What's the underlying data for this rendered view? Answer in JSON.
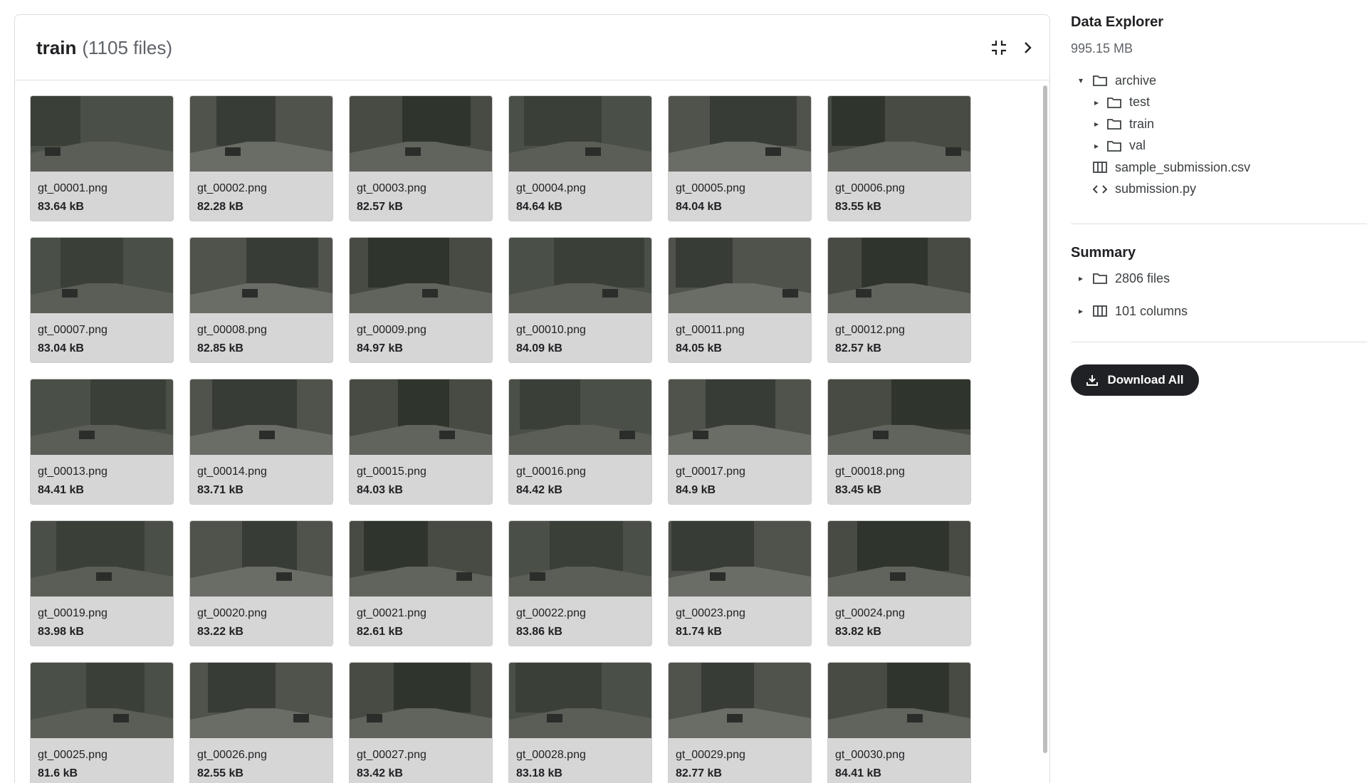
{
  "folder": {
    "name": "train",
    "count_label": "(1105 files)"
  },
  "files": [
    {
      "name": "gt_00001.png",
      "size": "83.64 kB"
    },
    {
      "name": "gt_00002.png",
      "size": "82.28 kB"
    },
    {
      "name": "gt_00003.png",
      "size": "82.57 kB"
    },
    {
      "name": "gt_00004.png",
      "size": "84.64 kB"
    },
    {
      "name": "gt_00005.png",
      "size": "84.04 kB"
    },
    {
      "name": "gt_00006.png",
      "size": "83.55 kB"
    },
    {
      "name": "gt_00007.png",
      "size": "83.04 kB"
    },
    {
      "name": "gt_00008.png",
      "size": "82.85 kB"
    },
    {
      "name": "gt_00009.png",
      "size": "84.97 kB"
    },
    {
      "name": "gt_00010.png",
      "size": "84.09 kB"
    },
    {
      "name": "gt_00011.png",
      "size": "84.05 kB"
    },
    {
      "name": "gt_00012.png",
      "size": "82.57 kB"
    },
    {
      "name": "gt_00013.png",
      "size": "84.41 kB"
    },
    {
      "name": "gt_00014.png",
      "size": "83.71 kB"
    },
    {
      "name": "gt_00015.png",
      "size": "84.03 kB"
    },
    {
      "name": "gt_00016.png",
      "size": "84.42 kB"
    },
    {
      "name": "gt_00017.png",
      "size": "84.9 kB"
    },
    {
      "name": "gt_00018.png",
      "size": "83.45 kB"
    },
    {
      "name": "gt_00019.png",
      "size": "83.98 kB"
    },
    {
      "name": "gt_00020.png",
      "size": "83.22 kB"
    },
    {
      "name": "gt_00021.png",
      "size": "82.61 kB"
    },
    {
      "name": "gt_00022.png",
      "size": "83.86 kB"
    },
    {
      "name": "gt_00023.png",
      "size": "81.74 kB"
    },
    {
      "name": "gt_00024.png",
      "size": "83.82 kB"
    },
    {
      "name": "gt_00025.png",
      "size": "81.6 kB"
    },
    {
      "name": "gt_00026.png",
      "size": "82.55 kB"
    },
    {
      "name": "gt_00027.png",
      "size": "83.42 kB"
    },
    {
      "name": "gt_00028.png",
      "size": "83.18 kB"
    },
    {
      "name": "gt_00029.png",
      "size": "82.77 kB"
    },
    {
      "name": "gt_00030.png",
      "size": "84.41 kB"
    }
  ],
  "sidebar": {
    "title": "Data Explorer",
    "size": "995.15 MB",
    "tree": {
      "root": "archive",
      "folders": [
        "test",
        "train",
        "val"
      ],
      "files": [
        "sample_submission.csv",
        "submission.py"
      ]
    },
    "summary": {
      "title": "Summary",
      "files": "2806 files",
      "columns": "101 columns"
    },
    "download_label": "Download All"
  },
  "icons": [
    "collapse-icon",
    "chevron-right-icon",
    "folder-icon",
    "table-icon",
    "code-icon",
    "download-icon",
    "caret-down-icon",
    "caret-right-icon"
  ],
  "colors": {
    "tile_bg": "#d6d6d6",
    "button_bg": "#202124",
    "text": "#202124",
    "muted": "#5f6368"
  }
}
